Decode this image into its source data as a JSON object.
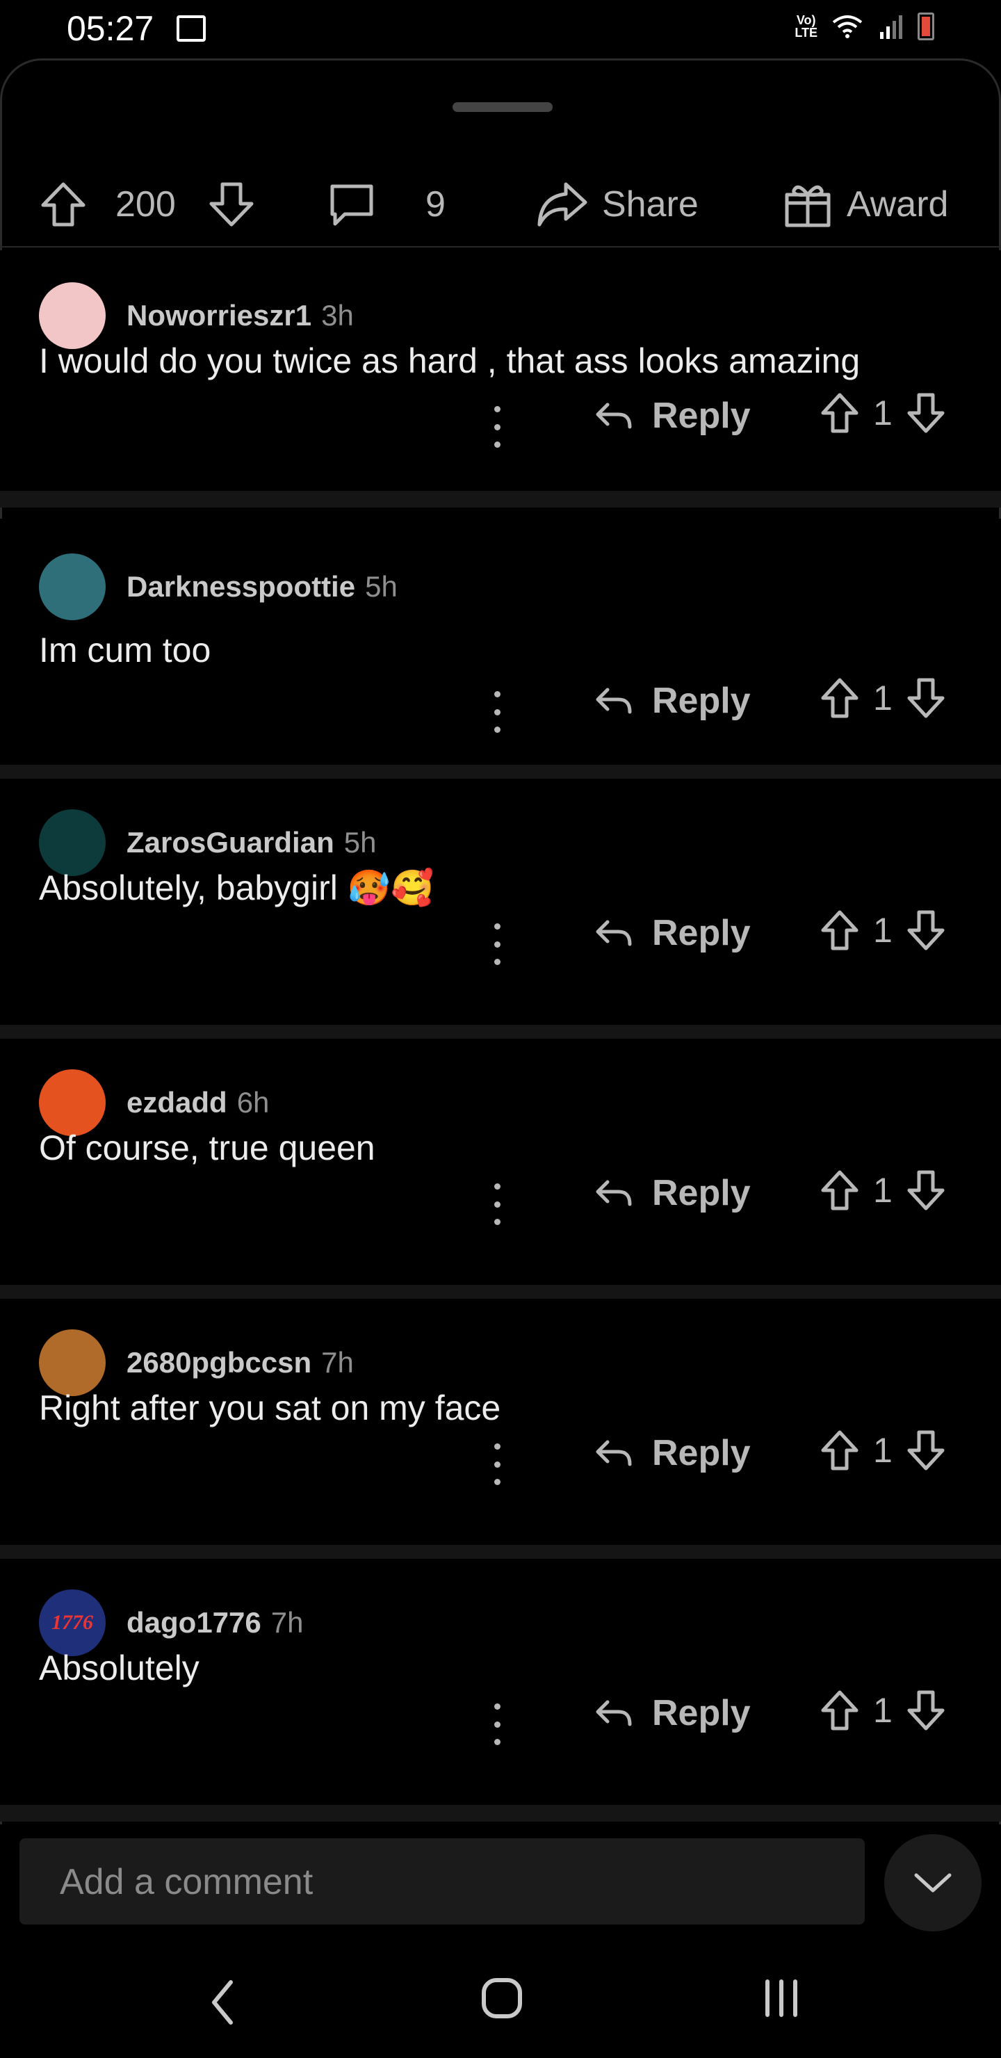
{
  "status_bar": {
    "time": "05:27",
    "network_line1": "Vo)",
    "network_line2": "LTE"
  },
  "post_actions": {
    "upvote_count": "200",
    "comment_count": "9",
    "share_label": "Share",
    "award_label": "Award"
  },
  "comments": [
    {
      "author": "Noworrieszr1",
      "age": "3h",
      "body": "I would do you twice as hard , that ass looks amazing",
      "score": "1",
      "reply_label": "Reply",
      "avatar_color": "#f2c6c6"
    },
    {
      "author": "Darknesspoottie",
      "age": "5h",
      "body": "Im cum too",
      "score": "1",
      "reply_label": "Reply",
      "avatar_color": "#2e6f7a"
    },
    {
      "author": "ZarosGuardian",
      "age": "5h",
      "body": "Absolutely, babygirl 🥵🥰",
      "score": "1",
      "reply_label": "Reply",
      "avatar_color": "#0d3a3a"
    },
    {
      "author": "ezdadd",
      "age": "6h",
      "body": "Of course, true queen",
      "score": "1",
      "reply_label": "Reply",
      "avatar_color": "#e4521f"
    },
    {
      "author": "2680pgbccsn",
      "age": "7h",
      "body": "Right after you sat on my face",
      "score": "1",
      "reply_label": "Reply",
      "avatar_color": "#b06a2a"
    },
    {
      "author": "dago1776",
      "age": "7h",
      "body": "Absolutely",
      "score": "1",
      "reply_label": "Reply",
      "avatar_color": "#1f2f7a",
      "avatar_text": "1776"
    }
  ],
  "composer": {
    "placeholder": "Add a comment"
  }
}
